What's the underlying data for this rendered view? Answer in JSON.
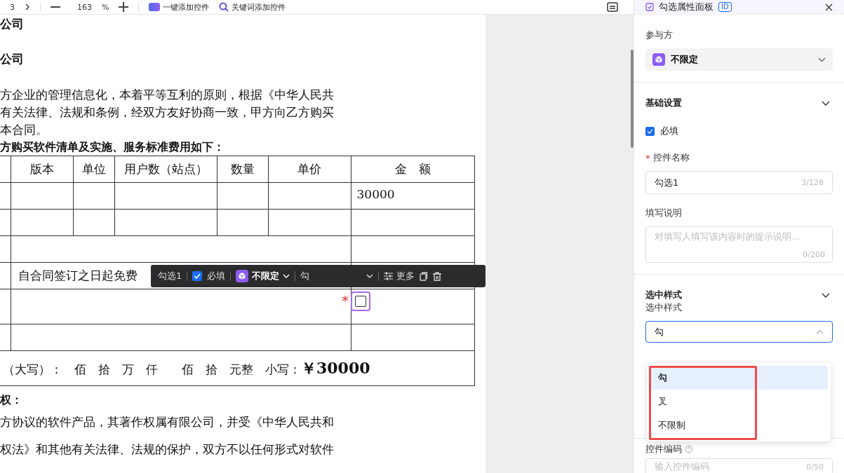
{
  "toolbar": {
    "page": "3",
    "zoom": "163",
    "zoom_unit": "%",
    "buttons": [
      {
        "kind": "ai",
        "label": "一键添加控件"
      },
      {
        "kind": "keyword",
        "label": "关键词添加控件"
      }
    ]
  },
  "document": {
    "top_lines": [
      {
        "kind": "heading",
        "text": "公司"
      },
      {
        "kind": "heading",
        "text": "公司"
      },
      {
        "kind": "gap"
      },
      {
        "kind": "para",
        "text": "方企业的管理信息化，本着平等互利的原则，根据《中华人民共"
      },
      {
        "kind": "para",
        "text": "有关法律、法规和条例，经双方友好协商一致，甲方向乙方购买"
      },
      {
        "kind": "para",
        "text": "本合同。"
      },
      {
        "kind": "bold",
        "text": "方购买软件清单及实施、服务标准费用如下："
      }
    ],
    "table": {
      "columns": [
        "版本",
        "单位",
        "用户数（站点）",
        "数量",
        "单价",
        "金　额"
      ],
      "rows": [
        {
          "kind": "item",
          "amount": "30000"
        },
        {
          "kind": "item"
        },
        {
          "kind": "wide"
        },
        {
          "kind": "wide",
          "text": "自合同签订之日起免费"
        },
        {
          "kind": "wide",
          "required_mark": "*",
          "checkbox": {
            "checked": false,
            "selected": true
          }
        },
        {
          "kind": "wide"
        },
        {
          "kind": "total",
          "text": "（大写）：　佰　拾　万　仟　　佰　拾　元整　小写：",
          "amount": "￥30000"
        }
      ]
    },
    "bottom_lines": [
      {
        "kind": "bold",
        "text": "权："
      },
      {
        "kind": "para",
        "text": "方协议的软件产品，其著作权属有限公司，并受《中华人民共和"
      },
      {
        "kind": "para",
        "text": "权法》和其他有关法律、法规的保护，双方不以任何形式对软件"
      }
    ]
  },
  "floating_toolbar": {
    "name": "勾选1",
    "required": {
      "label": "必填",
      "checked": true
    },
    "party": "不限定",
    "style": "勾",
    "more": "更多"
  },
  "panel": {
    "title": "勾选属性面板",
    "badge": "ID",
    "party": {
      "label": "参与方",
      "value": "不限定"
    },
    "basic": {
      "title": "基础设置",
      "expanded": true,
      "required": {
        "label": "必填",
        "checked": true
      },
      "name_required_mark": "*",
      "name_label": "控件名称",
      "name_value": "勾选1",
      "name_count": "3/128",
      "desc_label": "填写说明",
      "desc_placeholder": "对填写人填写该内容时的提示说明...",
      "desc_count": "0/200"
    },
    "style": {
      "title": "选中样式",
      "expanded": true,
      "label": "选中样式",
      "value": "勾",
      "open": true,
      "options": [
        {
          "label": "勾",
          "selected": true
        },
        {
          "label": "叉",
          "selected": false
        },
        {
          "label": "不限制",
          "selected": false
        }
      ]
    },
    "code": {
      "label": "控件编码",
      "placeholder": "输入控件编码",
      "count": "0/50"
    }
  }
}
